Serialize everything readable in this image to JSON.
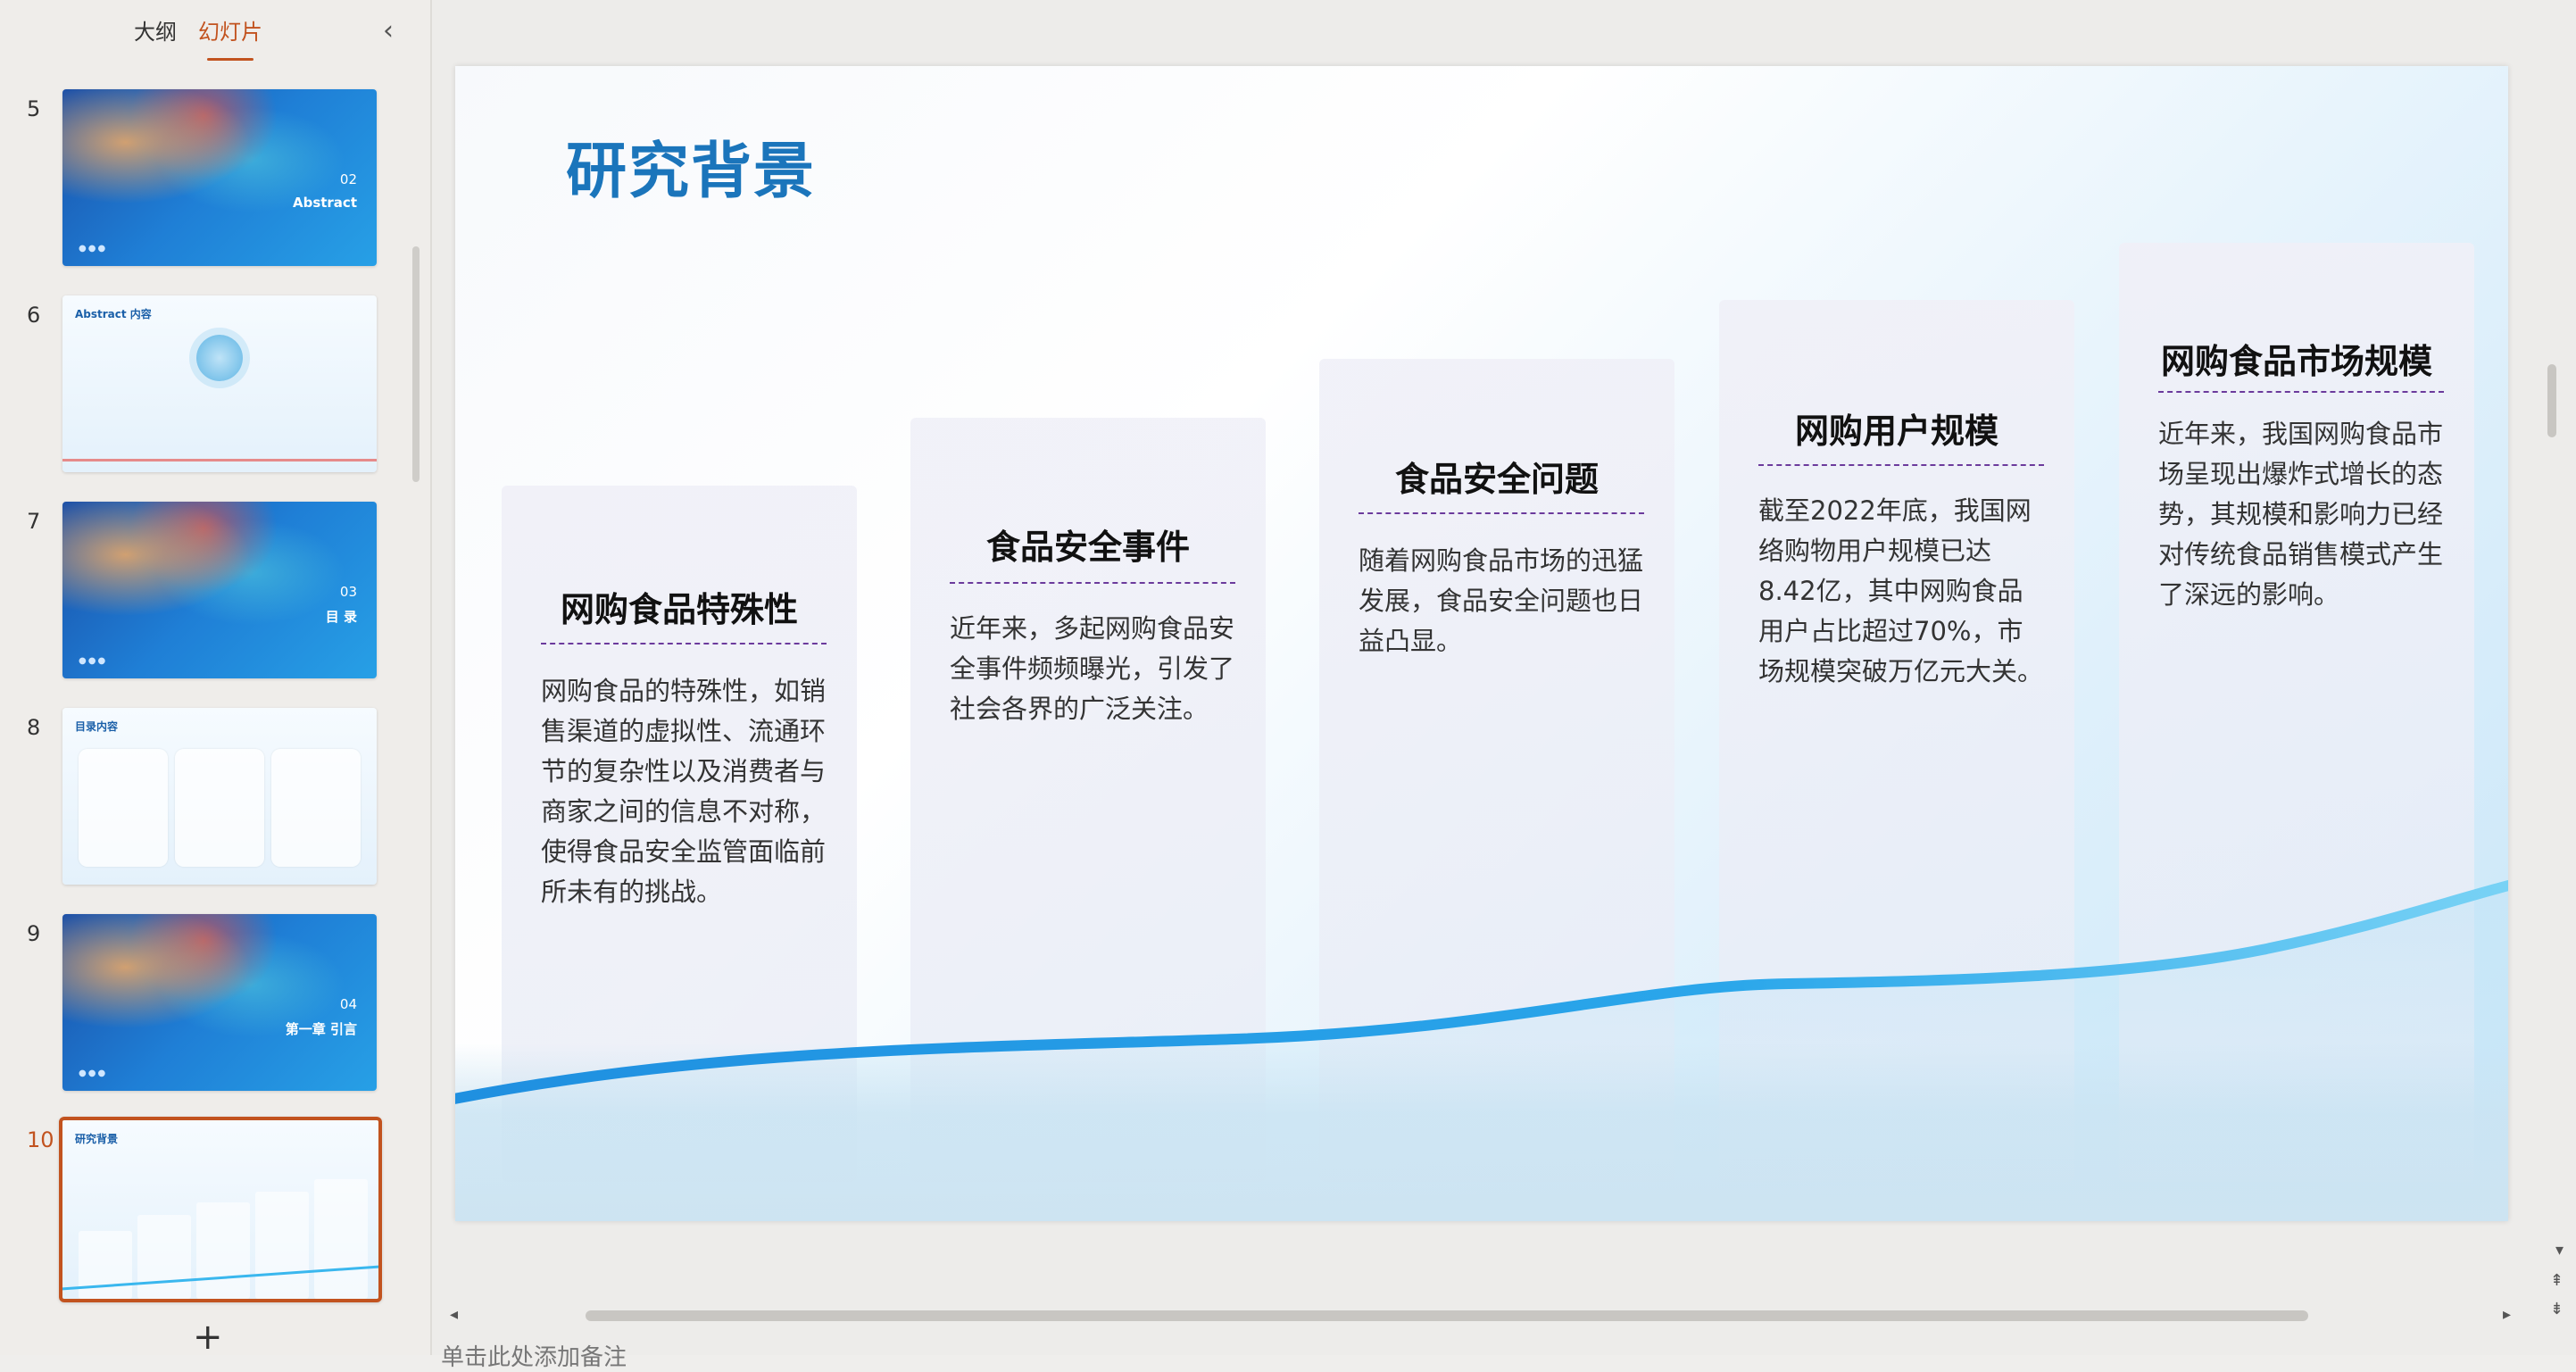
{
  "panel": {
    "tabs": [
      {
        "label": "大纲",
        "active": false
      },
      {
        "label": "幻灯片",
        "active": true
      }
    ],
    "collapse_icon": "chevron-left-icon",
    "add_icon": "plus-icon",
    "add_label": "+"
  },
  "thumbnails": [
    {
      "number": "5",
      "kind": "dark",
      "caption_num": "02",
      "caption_title": "Abstract"
    },
    {
      "number": "6",
      "kind": "light",
      "title": "Abstract 内容"
    },
    {
      "number": "7",
      "kind": "dark",
      "caption_num": "03",
      "caption_title": "目 录"
    },
    {
      "number": "8",
      "kind": "light",
      "title": "目录内容"
    },
    {
      "number": "9",
      "kind": "dark",
      "caption_num": "04",
      "caption_title": "第一章 引言"
    },
    {
      "number": "10",
      "kind": "light",
      "title": "研究背景",
      "selected": true
    }
  ],
  "slide": {
    "title": "研究背景",
    "columns": [
      {
        "heading": "网购食品特殊性",
        "body": "网购食品的特殊性，如销售渠道的虚拟性、流通环节的复杂性以及消费者与商家之间的信息不对称，使得食品安全监管面临前所未有的挑战。"
      },
      {
        "heading": "食品安全事件",
        "body": "近年来，多起网购食品安全事件频频曝光，引发了社会各界的广泛关注。"
      },
      {
        "heading": "食品安全问题",
        "body": "随着网购食品市场的迅猛发展，食品安全问题也日益凸显。"
      },
      {
        "heading": "网购用户规模",
        "body": "截至2022年底，我国网络购物用户规模已达8.42亿，其中网购食品用户占比超过70%，市场规模突破万亿元大关。"
      },
      {
        "heading": "网购食品市场规模",
        "body": "近年来，我国网购食品市场呈现出爆炸式增长的态势，其规模和影响力已经对传统食品销售模式产生了深远的影响。"
      }
    ]
  },
  "notes": {
    "placeholder": "单击此处添加备注"
  },
  "colors": {
    "accent": "#c2531f",
    "title_blue": "#1b75bb",
    "dash_purple": "#6b3a9c",
    "wave_blue": "#2aa6ea"
  }
}
